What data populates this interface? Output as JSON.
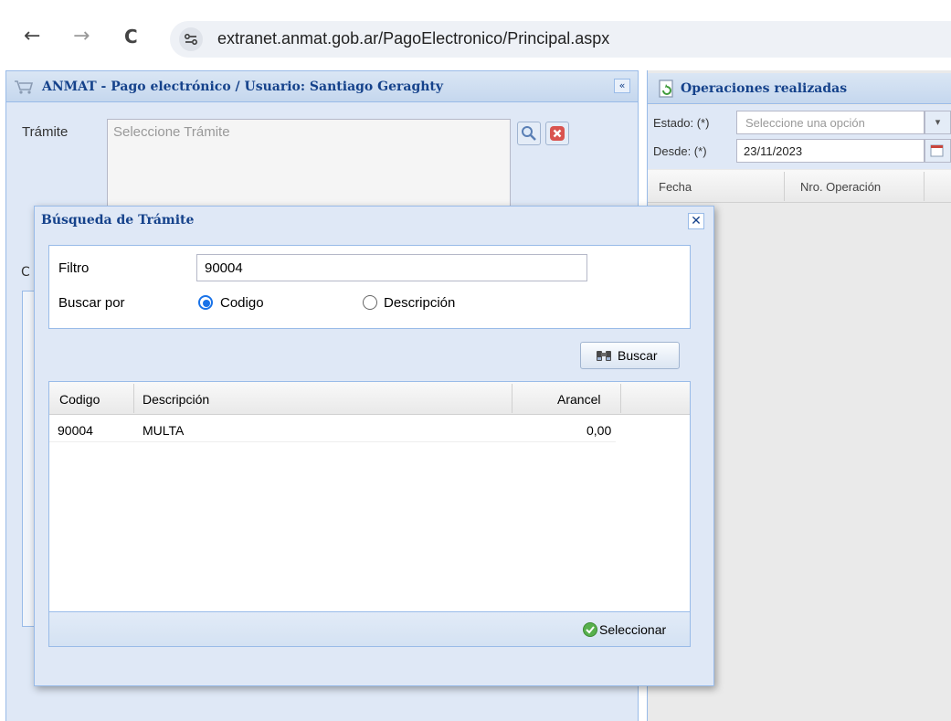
{
  "browser": {
    "url": "extranet.anmat.gob.ar/PagoElectronico/Principal.aspx",
    "back": "←",
    "forward": "→",
    "reload": "C"
  },
  "left_panel": {
    "title": "ANMAT - Pago electrónico / Usuario: Santiago Geraghty",
    "collapse": "«",
    "tramite_label": "Trámite",
    "tramite_placeholder": "Seleccione Trámite",
    "partial_label": "C"
  },
  "right_panel": {
    "title": "Operaciones realizadas",
    "estado_label": "Estado: (*)",
    "estado_placeholder": "Seleccione una opción",
    "desde_label": "Desde: (*)",
    "desde_value": "23/11/2023",
    "columns": [
      "Fecha",
      "Nro. Operación"
    ]
  },
  "modal": {
    "title": "Búsqueda de Trámite",
    "close": "✕",
    "filtro_label": "Filtro",
    "filtro_value": "90004",
    "buscar_por_label": "Buscar por",
    "radio_codigo": "Codigo",
    "radio_descripcion": "Descripción",
    "buscar_button": "Buscar",
    "seleccionar_button": "Seleccionar",
    "columns": [
      "Codigo",
      "Descripción",
      "Arancel"
    ],
    "rows": [
      {
        "codigo": "90004",
        "descripcion": "MULTA",
        "arancel": "0,00"
      }
    ],
    "colors": {
      "header_text": "#15428b",
      "border": "#99bbe8",
      "panel_bg": "#dfe8f6"
    }
  }
}
